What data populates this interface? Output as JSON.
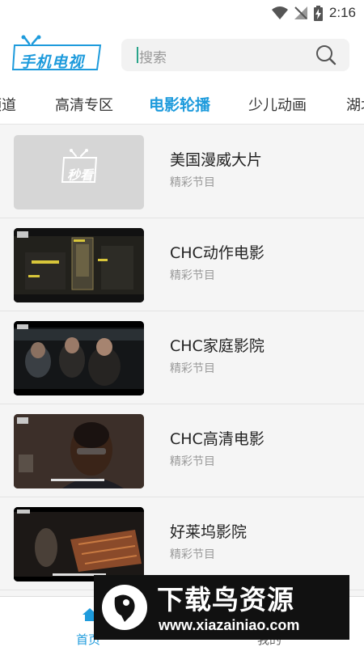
{
  "status_bar": {
    "time": "2:16",
    "icons": [
      "wifi-icon",
      "no-signal-icon",
      "battery-charging-icon"
    ]
  },
  "header": {
    "logo_text": "手机电视",
    "search_placeholder": "搜索"
  },
  "tabs": [
    "频道",
    "高清专区",
    "电影轮播",
    "少儿动画",
    "湖北"
  ],
  "active_tab": "电影轮播",
  "channels": [
    {
      "title": "美国漫威大片",
      "subtitle": "精彩节目",
      "thumb_text": "秒看"
    },
    {
      "title": "CHC动作电影",
      "subtitle": "精彩节目"
    },
    {
      "title": "CHC家庭影院",
      "subtitle": "精彩节目"
    },
    {
      "title": "CHC高清电影",
      "subtitle": "精彩节目"
    },
    {
      "title": "好莱坞影院",
      "subtitle": "精彩节目"
    }
  ],
  "bottom_nav": {
    "home_label": "首页",
    "mine_label": "我的"
  },
  "watermark": {
    "title": "下载鸟资源",
    "url": "www.xiazainiao.com"
  },
  "colors": {
    "accent": "#1e9bdc",
    "background": "#f5f5f5"
  }
}
